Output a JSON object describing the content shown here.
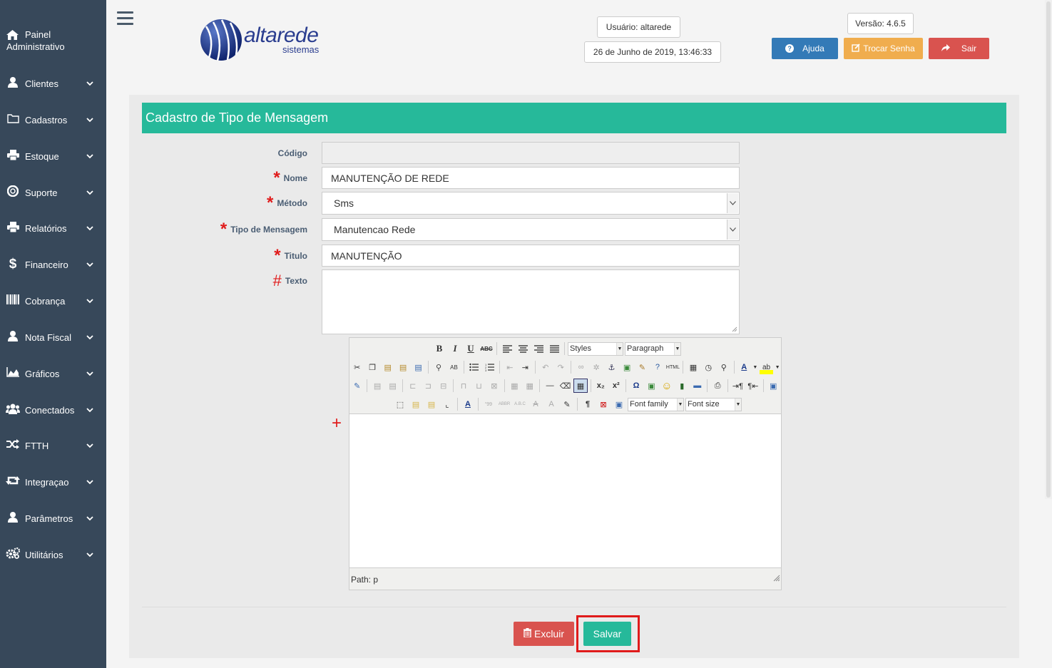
{
  "sidebar": {
    "header": {
      "line1": "Painel",
      "line2": "Administrativo"
    },
    "items": [
      {
        "label": "Clientes",
        "icon": "user-icon"
      },
      {
        "label": "Cadastros",
        "icon": "folder-icon"
      },
      {
        "label": "Estoque",
        "icon": "print-icon"
      },
      {
        "label": "Suporte",
        "icon": "lifebuoy-icon"
      },
      {
        "label": "Relatórios",
        "icon": "print-icon"
      },
      {
        "label": "Financeiro",
        "icon": "dollar-icon"
      },
      {
        "label": "Cobrança",
        "icon": "barcode-icon"
      },
      {
        "label": "Nota Fiscal",
        "icon": "user-icon"
      },
      {
        "label": "Gráficos",
        "icon": "area-chart-icon"
      },
      {
        "label": "Conectados",
        "icon": "users-icon"
      },
      {
        "label": "FTTH",
        "icon": "random-icon"
      },
      {
        "label": "Integraçao",
        "icon": "retweet-icon"
      },
      {
        "label": "Parâmetros",
        "icon": "user-icon"
      },
      {
        "label": "Utilitários",
        "icon": "cogs-icon"
      }
    ]
  },
  "header": {
    "logo_main": "altarede",
    "logo_sub": "sistemas",
    "user": "Usuário: altarede",
    "datetime": "26 de Junho de 2019, 13:46:33",
    "version": "Versão: 4.6.5",
    "help_label": "Ajuda",
    "change_password_label": "Trocar Senha",
    "logout_label": "Sair",
    "colors": {
      "help": "#337ab7",
      "change_password": "#f0ad4e",
      "logout": "#d9534f"
    }
  },
  "form": {
    "title": "Cadastro de Tipo de Mensagem",
    "labels": {
      "codigo": "Código",
      "nome": "Nome",
      "metodo": "Método",
      "tipo": "Tipo de Mensagem",
      "titulo": "Titulo",
      "texto": "Texto"
    },
    "required_mark": "*",
    "hash_mark": "#",
    "plus_mark": "+",
    "values": {
      "codigo": "",
      "nome": "MANUTENÇÃO DE REDE",
      "metodo": "Sms",
      "tipo": "Manutencao Rede",
      "titulo": "MANUTENÇÃO",
      "texto": ""
    }
  },
  "editor": {
    "styles_label": "Styles",
    "paragraph_label": "Paragraph",
    "font_family_label": "Font family",
    "font_size_label": "Font size",
    "path": "Path: p"
  },
  "actions": {
    "delete_label": "Excluir",
    "save_label": "Salvar",
    "delete_color": "#d9534f",
    "save_color": "#26b99a",
    "highlight_color": "#e01b1b"
  }
}
